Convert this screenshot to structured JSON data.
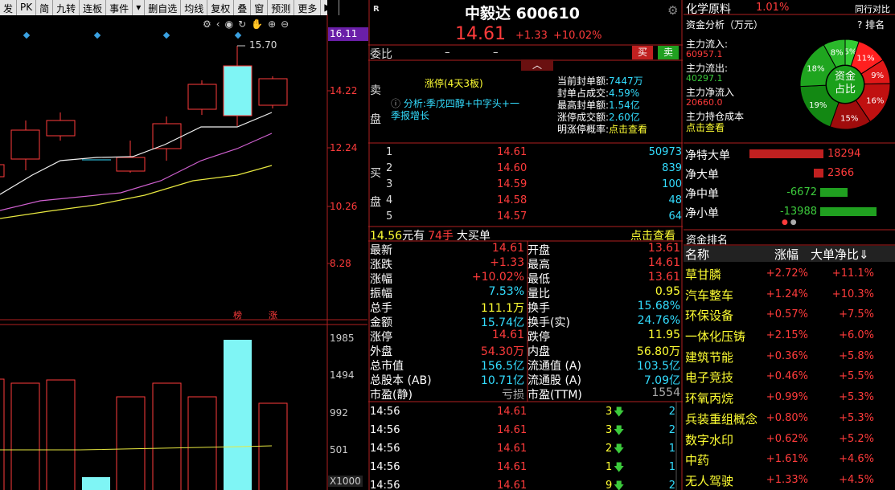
{
  "toolbar": [
    "发",
    "PK",
    "简",
    "九转",
    "连板",
    "事件",
    "",
    "删自选",
    "均线",
    "复权",
    "叠",
    "窗",
    "预测",
    "更多",
    "▶|"
  ],
  "left_chart": {
    "price_ticks": [
      "16.11",
      "14.22",
      "12.24",
      "10.26",
      "8.28"
    ],
    "high_label": "15.70",
    "volume_ticks": [
      "1985",
      "1494",
      "992",
      "501",
      "X1000"
    ],
    "badge_bang": "榜",
    "badge_zhang": "涨"
  },
  "stock": {
    "r_tag": "R",
    "name": "中毅达 600610",
    "price": "14.61",
    "change": "+1.33",
    "change_pct": "+10.02%"
  },
  "weibi": {
    "label": "委比",
    "v1": "–",
    "v2": "–",
    "buy": "买",
    "sell": "卖"
  },
  "sell_side": {
    "label": "卖盘",
    "limit_text": "涨停(4天3板)",
    "analysis_prefix": "分析:",
    "analysis_text": "季戊四醇+中字头+一季报增长",
    "stats": [
      {
        "k": "当前封单额:",
        "v": "7447万"
      },
      {
        "k": "封单占成交:",
        "v": "4.59%"
      },
      {
        "k": "最高封单额:",
        "v": "1.54亿"
      },
      {
        "k": "涨停成交额:",
        "v": "2.60亿"
      },
      {
        "k": "明涨停概率:",
        "v": "点击查看"
      }
    ]
  },
  "buy_side": {
    "label": "买盘",
    "rows": [
      {
        "n": "1",
        "p": "14.61",
        "v": "50973"
      },
      {
        "n": "2",
        "p": "14.60",
        "v": "839"
      },
      {
        "n": "3",
        "p": "14.59",
        "v": "100"
      },
      {
        "n": "4",
        "p": "14.58",
        "v": "48"
      },
      {
        "n": "5",
        "p": "14.57",
        "v": "64"
      }
    ]
  },
  "big_order": {
    "price": "14.56",
    "text1": "元有",
    "qty": "74手",
    "text2": "大买单",
    "link": "点击查看"
  },
  "quote": [
    {
      "k1": "最新",
      "v1": "14.61",
      "c1": "red",
      "k2": "开盘",
      "v2": "13.61",
      "c2": "red"
    },
    {
      "k1": "涨跌",
      "v1": "+1.33",
      "c1": "red",
      "k2": "最高",
      "v2": "14.61",
      "c2": "red"
    },
    {
      "k1": "涨幅",
      "v1": "+10.02%",
      "c1": "red",
      "k2": "最低",
      "v2": "13.61",
      "c2": "red"
    },
    {
      "k1": "振幅",
      "v1": "7.53%",
      "c1": "cyan",
      "k2": "量比",
      "v2": "0.95",
      "c2": "yellow"
    },
    {
      "k1": "总手",
      "v1": "111.1万",
      "c1": "yellow",
      "k2": "换手",
      "v2": "15.68%",
      "c2": "cyan"
    },
    {
      "k1": "金额",
      "v1": "15.74亿",
      "c1": "cyan",
      "k2": "换手(实)",
      "v2": "24.76%",
      "c2": "cyan"
    },
    {
      "k1": "涨停",
      "v1": "14.61",
      "c1": "red",
      "k2": "跌停",
      "v2": "11.95",
      "c2": "yellow"
    },
    {
      "k1": "外盘",
      "v1": "54.30万",
      "c1": "red",
      "k2": "内盘",
      "v2": "56.80万",
      "c2": "yellow"
    },
    {
      "k1": "总市值",
      "v1": "156.5亿",
      "c1": "cyan",
      "k2": "流通值 (A)",
      "v2": "103.5亿",
      "c2": "cyan"
    },
    {
      "k1": "总股本 (AB)",
      "v1": "10.71亿",
      "c1": "cyan",
      "k2": "流通股 (A)",
      "v2": "7.09亿",
      "c2": "cyan"
    },
    {
      "k1": "市盈(静)",
      "v1": "亏损",
      "c1": "gray",
      "k2": "市盈(TTM)",
      "v2": "1554",
      "c2": "gray"
    }
  ],
  "ticks": [
    {
      "t": "14:56",
      "p": "14.61",
      "v": "3",
      "n": "2"
    },
    {
      "t": "14:56",
      "p": "14.61",
      "v": "3",
      "n": "2"
    },
    {
      "t": "14:56",
      "p": "14.61",
      "v": "2",
      "n": "1"
    },
    {
      "t": "14:56",
      "p": "14.61",
      "v": "1",
      "n": "1"
    },
    {
      "t": "14:56",
      "p": "14.61",
      "v": "9",
      "n": "2"
    }
  ],
  "right": {
    "sector": "化学原料",
    "sector_pct": "1.01%",
    "sector_tag": "同行对比",
    "fund_title": "资金分析（万元）",
    "rank_link": "? 排名",
    "inflow_label": "主力流入:",
    "inflow": "60957.1",
    "outflow_label": "主力流出:",
    "outflow": "40297.1",
    "net_label": "主力净流入",
    "net": "20660.0",
    "cost_label": "主力持仓成本",
    "cost_link": "点击查看",
    "pie_center": "资金占比",
    "pie_slices": [
      {
        "label": "5%",
        "value": 5,
        "color": "#33cc33"
      },
      {
        "label": "11%",
        "value": 11,
        "color": "#ff2020"
      },
      {
        "label": "9%",
        "value": 9,
        "color": "#e01818"
      },
      {
        "label": "16%",
        "value": 16,
        "color": "#c01010"
      },
      {
        "label": "15%",
        "value": 15,
        "color": "#a00c0c"
      },
      {
        "label": "19%",
        "value": 19,
        "color": "#138813"
      },
      {
        "label": "18%",
        "value": 18,
        "color": "#1fa51f"
      },
      {
        "label": "8%",
        "value": 8,
        "color": "#2ab82a"
      }
    ],
    "flows": [
      {
        "label": "净特大单",
        "value": "18294",
        "frac": 1.0,
        "dir": "pos"
      },
      {
        "label": "净大单",
        "value": "2366",
        "frac": 0.13,
        "dir": "pos"
      },
      {
        "label": "净中单",
        "value": "-6672",
        "frac": 0.37,
        "dir": "neg"
      },
      {
        "label": "净小单",
        "value": "-13988",
        "frac": 0.76,
        "dir": "neg"
      }
    ],
    "rank_title": "资金排名",
    "rank_headers": [
      "名称",
      "涨幅",
      "大单净比"
    ],
    "rank_rows": [
      {
        "name": "草甘膦",
        "pct": "+2.72%",
        "ratio": "+11.1%"
      },
      {
        "name": "汽车整车",
        "pct": "+1.24%",
        "ratio": "+10.3%"
      },
      {
        "name": "环保设备",
        "pct": "+0.57%",
        "ratio": "+7.5%"
      },
      {
        "name": "一体化压铸",
        "pct": "+2.15%",
        "ratio": "+6.0%"
      },
      {
        "name": "建筑节能",
        "pct": "+0.36%",
        "ratio": "+5.8%"
      },
      {
        "name": "电子竞技",
        "pct": "+0.46%",
        "ratio": "+5.5%"
      },
      {
        "name": "环氧丙烷",
        "pct": "+0.99%",
        "ratio": "+5.3%"
      },
      {
        "name": "兵装重组概念",
        "pct": "+0.80%",
        "ratio": "+5.3%"
      },
      {
        "name": "数字水印",
        "pct": "+0.62%",
        "ratio": "+5.2%"
      },
      {
        "name": "中药",
        "pct": "+1.61%",
        "ratio": "+4.6%"
      },
      {
        "name": "无人驾驶",
        "pct": "+1.33%",
        "ratio": "+4.5%"
      }
    ]
  }
}
